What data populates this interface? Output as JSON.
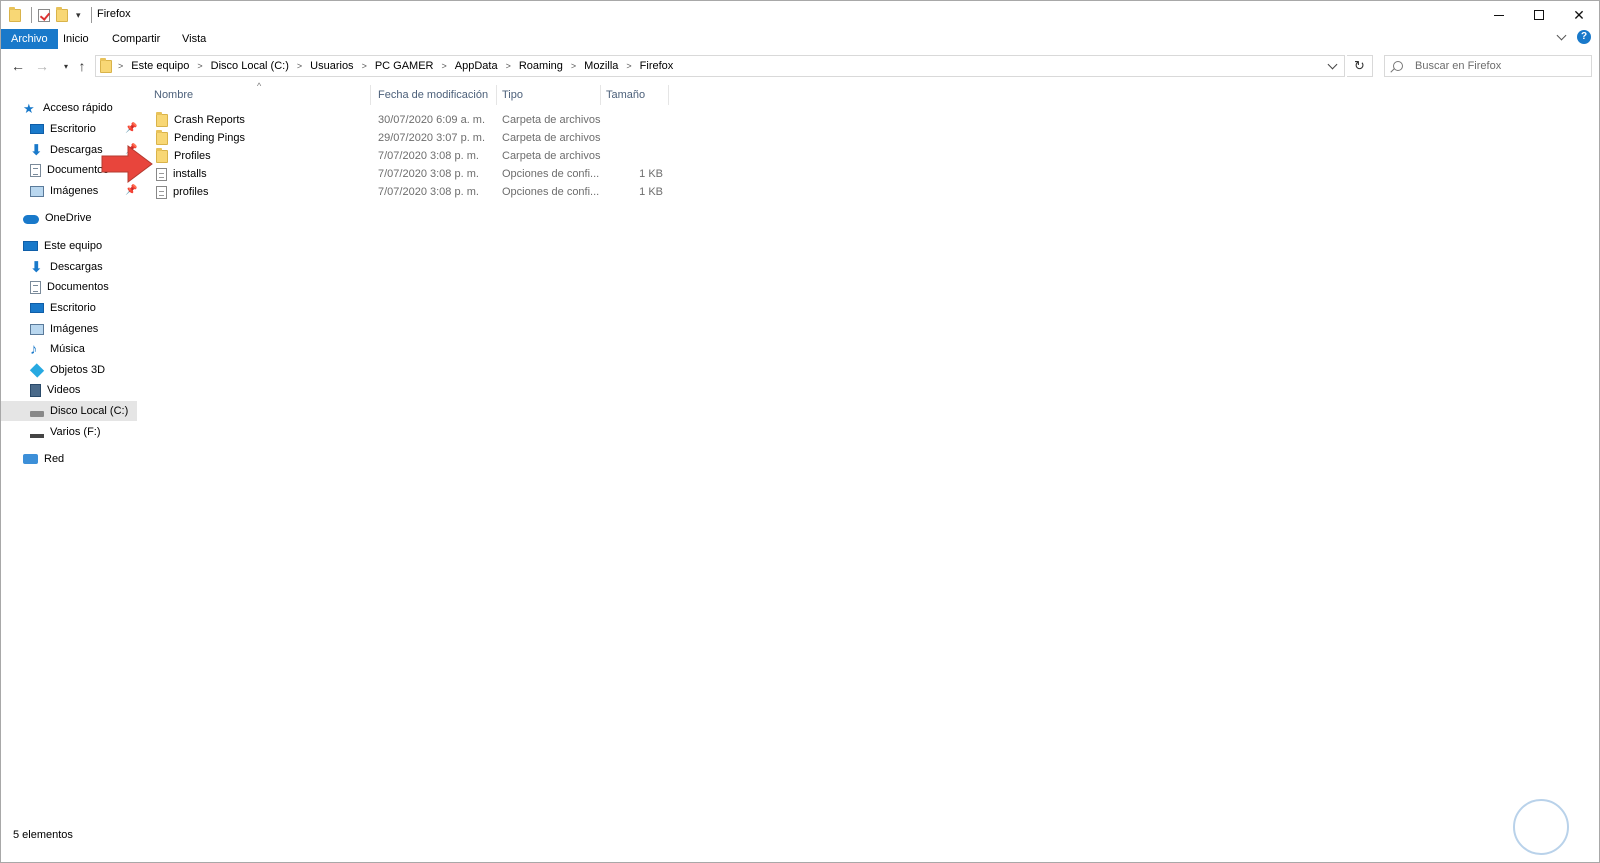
{
  "window": {
    "title": "Firefox",
    "controls": {
      "minimize": "—",
      "maximize": "",
      "close": "✕"
    }
  },
  "ribbon": {
    "tabs": [
      "Archivo",
      "Inicio",
      "Compartir",
      "Vista"
    ],
    "help": "?"
  },
  "navigation": {
    "back": "←",
    "forward": "→",
    "recent": "▾",
    "up": "↑",
    "breadcrumb": [
      "Este equipo",
      "Disco Local (C:)",
      "Usuarios",
      "PC GAMER",
      "AppData",
      "Roaming",
      "Mozilla",
      "Firefox"
    ],
    "refresh": "↻",
    "search_placeholder": "Buscar en Firefox"
  },
  "sidebar": {
    "quick_access": {
      "label": "Acceso rápido",
      "items": [
        {
          "label": "Escritorio",
          "icon": "desktop-icon",
          "pinned": true
        },
        {
          "label": "Descargas",
          "icon": "download-icon",
          "pinned": true
        },
        {
          "label": "Documentos",
          "icon": "document-icon",
          "pinned": true
        },
        {
          "label": "Imágenes",
          "icon": "image-icon",
          "pinned": true
        }
      ]
    },
    "onedrive": {
      "label": "OneDrive"
    },
    "this_pc": {
      "label": "Este equipo",
      "items": [
        {
          "label": "Descargas",
          "icon": "download-icon"
        },
        {
          "label": "Documentos",
          "icon": "document-icon"
        },
        {
          "label": "Escritorio",
          "icon": "desktop-icon"
        },
        {
          "label": "Imágenes",
          "icon": "image-icon"
        },
        {
          "label": "Música",
          "icon": "music-icon"
        },
        {
          "label": "Objetos 3D",
          "icon": "3d-objects-icon"
        },
        {
          "label": "Videos",
          "icon": "video-icon"
        },
        {
          "label": "Disco Local (C:)",
          "icon": "drive-icon",
          "selected": true
        },
        {
          "label": "Varios (F:)",
          "icon": "drive-icon"
        }
      ]
    },
    "network": {
      "label": "Red"
    },
    "pin_glyph": "📌"
  },
  "file_list": {
    "columns": [
      "Nombre",
      "Fecha de modificación",
      "Tipo",
      "Tamaño"
    ],
    "sort_glyph": "^",
    "rows": [
      {
        "name": "Crash Reports",
        "date": "30/07/2020 6:09 a. m.",
        "type": "Carpeta de archivos",
        "size": "",
        "kind": "folder"
      },
      {
        "name": "Pending Pings",
        "date": "29/07/2020 3:07 p. m.",
        "type": "Carpeta de archivos",
        "size": "",
        "kind": "folder"
      },
      {
        "name": "Profiles",
        "date": "7/07/2020 3:08 p. m.",
        "type": "Carpeta de archivos",
        "size": "",
        "kind": "folder"
      },
      {
        "name": "installs",
        "date": "7/07/2020 3:08 p. m.",
        "type": "Opciones de confi...",
        "size": "1 KB",
        "kind": "file"
      },
      {
        "name": "profiles",
        "date": "7/07/2020 3:08 p. m.",
        "type": "Opciones de confi...",
        "size": "1 KB",
        "kind": "file"
      }
    ]
  },
  "status": {
    "count": "5 elementos"
  },
  "colors": {
    "accent": "#1979ca",
    "folder": "#f8d775",
    "arrow": "#e8453c"
  }
}
